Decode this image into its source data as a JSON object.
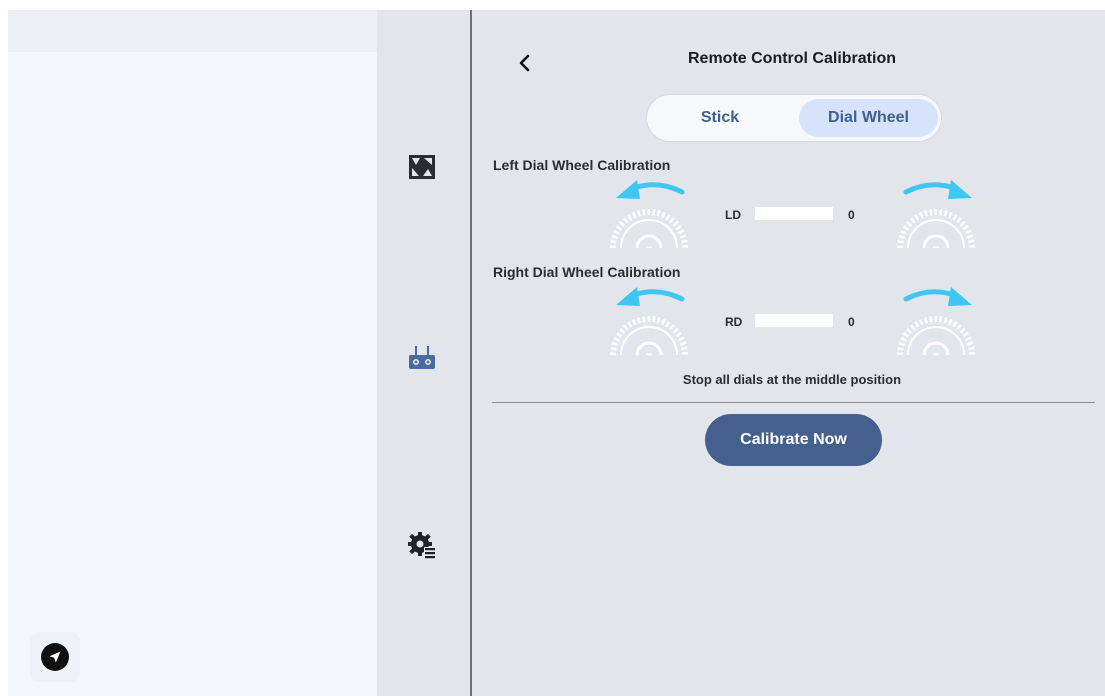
{
  "header": {
    "title": "Remote Control Calibration"
  },
  "tabs": [
    {
      "label": "Stick",
      "selected": false
    },
    {
      "label": "Dial Wheel",
      "selected": true
    }
  ],
  "left_dial": {
    "heading": "Left Dial Wheel Calibration",
    "axis_label": "LD",
    "value": "0",
    "bar_fill_fraction": 0
  },
  "right_dial": {
    "heading": "Right Dial Wheel Calibration",
    "axis_label": "RD",
    "value": "0",
    "bar_fill_fraction": 0
  },
  "hint": "Stop all dials at the middle position",
  "actions": {
    "calibrate_label": "Calibrate Now"
  },
  "rail_icons": [
    "camera-aperture-icon",
    "remote-controller-icon",
    "gear-settings-icon"
  ],
  "colors": {
    "accent": "#45608c",
    "arrow": "#3fc6f2",
    "wheel": "#ffffff",
    "tab_selected_bg": "#d7e3fb",
    "panel_bg": "#e3e5ec"
  }
}
